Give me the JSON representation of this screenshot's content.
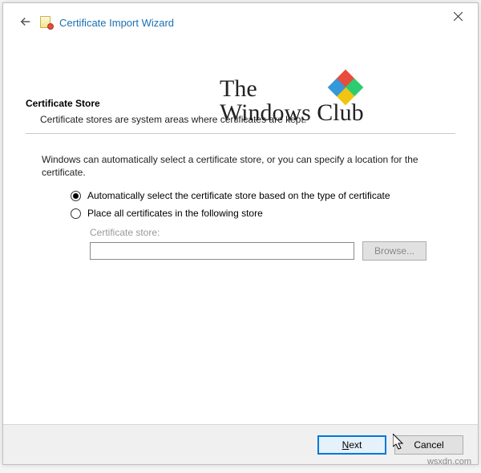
{
  "window": {
    "title": "Certificate Import Wizard"
  },
  "watermark": {
    "line1": "The",
    "line2": "Windows Club",
    "footer_credit": "wsxdn.com"
  },
  "section": {
    "heading": "Certificate Store",
    "description": "Certificate stores are system areas where certificates are kept."
  },
  "body": {
    "intro": "Windows can automatically select a certificate store, or you can specify a location for the certificate.",
    "option_auto": "Automatically select the certificate store based on the type of certificate",
    "option_manual": "Place all certificates in the following store",
    "selected": "auto",
    "store_label": "Certificate store:",
    "store_value": "",
    "browse_label": "Browse..."
  },
  "footer": {
    "next_label": "Next",
    "cancel_label": "Cancel"
  }
}
